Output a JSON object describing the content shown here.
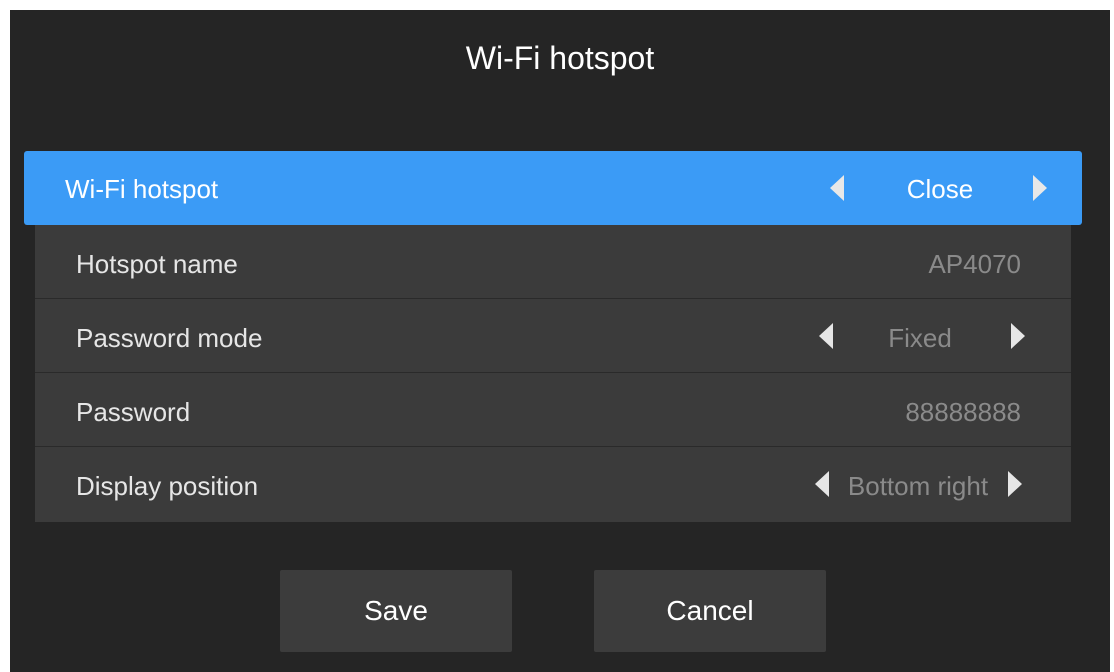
{
  "dialog": {
    "title": "Wi-Fi hotspot"
  },
  "settings": [
    {
      "label": "Wi-Fi hotspot",
      "value": "Close",
      "control": "selector",
      "selected": true
    },
    {
      "label": "Hotspot name",
      "value": "AP4070",
      "control": "text"
    },
    {
      "label": "Password mode",
      "value": "Fixed",
      "control": "selector"
    },
    {
      "label": "Password",
      "value": "88888888",
      "control": "text"
    },
    {
      "label": "Display position",
      "value": "Bottom right",
      "control": "selector"
    }
  ],
  "buttons": {
    "save_label": "Save",
    "cancel_label": "Cancel"
  },
  "colors": {
    "background": "#252525",
    "selected_row": "#3b9bf6",
    "list_background": "#3b3b3b",
    "button_background": "#3c3c3c",
    "muted_value": "#8a8a8a"
  },
  "icons": {
    "prev": "triangle-left-icon",
    "next": "triangle-right-icon"
  }
}
